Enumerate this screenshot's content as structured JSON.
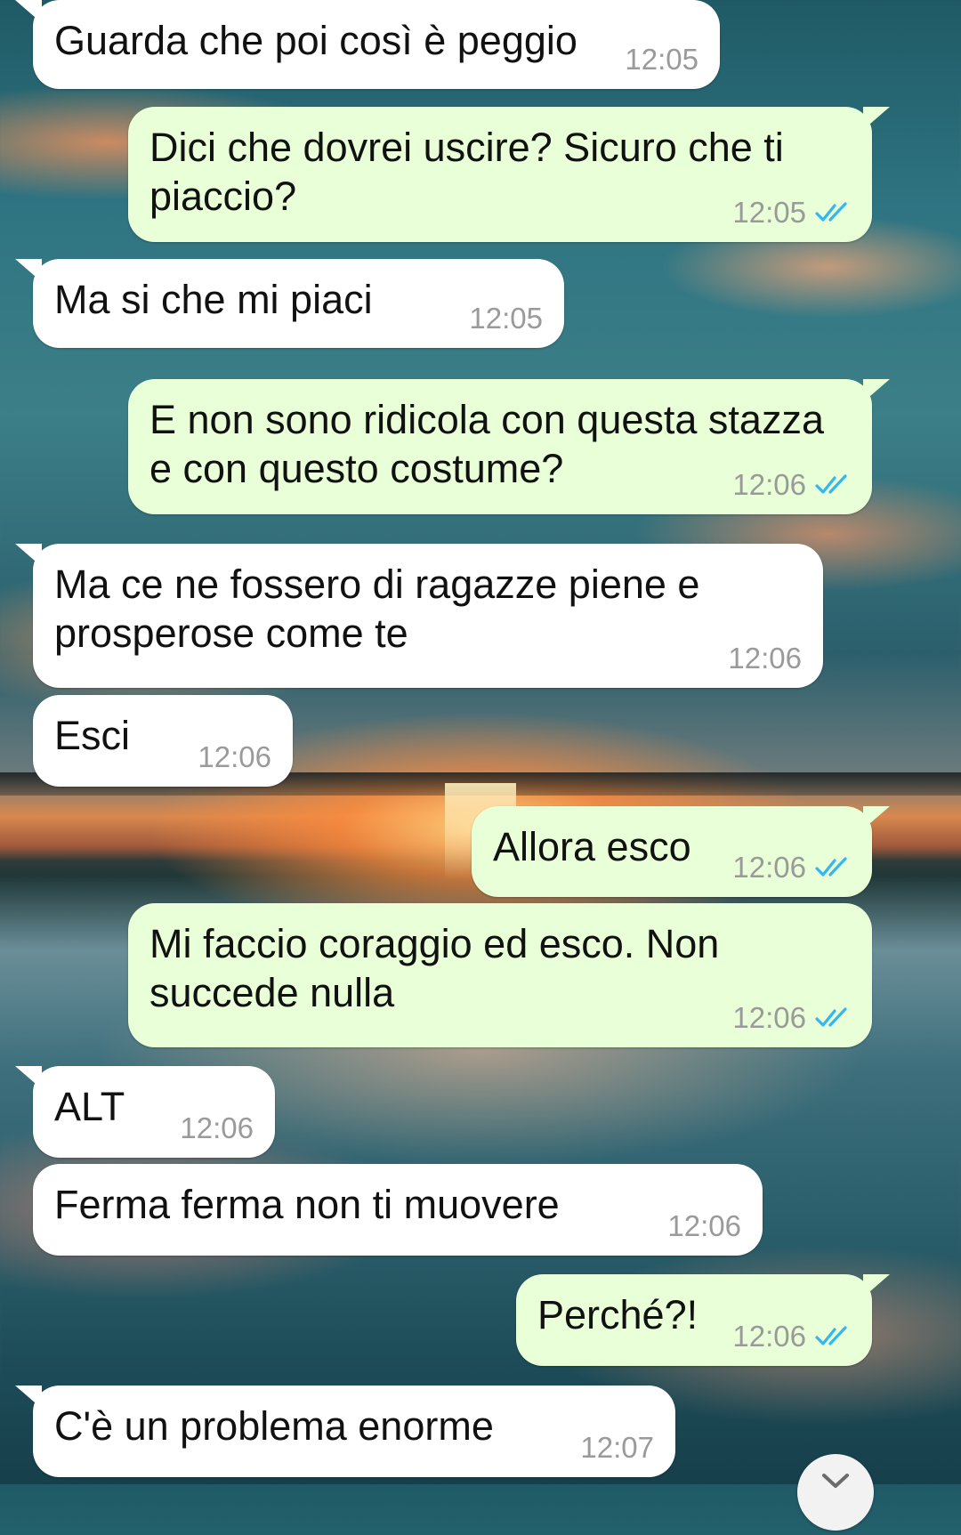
{
  "messages": [
    {
      "direction": "in",
      "text": "Guarda che poi così è peggio",
      "time": "12:05"
    },
    {
      "direction": "out",
      "text": "Dici che dovrei uscire? Sicuro che ti\npiaccio?",
      "time": "12:05",
      "status": "read"
    },
    {
      "direction": "in",
      "text": "Ma si che mi piaci",
      "time": "12:05"
    },
    {
      "direction": "out",
      "text": "E non sono ridicola con questa stazza\ne con questo costume?",
      "time": "12:06",
      "status": "read"
    },
    {
      "direction": "in",
      "text": "Ma ce ne fossero di ragazze piene e\nprosperose come te",
      "time": "12:06"
    },
    {
      "direction": "in",
      "text": "Esci",
      "time": "12:06"
    },
    {
      "direction": "out",
      "text": "Allora esco",
      "time": "12:06",
      "status": "read"
    },
    {
      "direction": "out",
      "text": "Mi faccio coraggio ed esco. Non\nsuccede nulla",
      "time": "12:06",
      "status": "read"
    },
    {
      "direction": "in",
      "text": "ALT",
      "time": "12:06"
    },
    {
      "direction": "in",
      "text": "Ferma ferma non ti muovere",
      "time": "12:06"
    },
    {
      "direction": "out",
      "text": "Perché?!",
      "time": "12:06",
      "status": "read"
    },
    {
      "direction": "in",
      "text": "C'è un problema enorme",
      "time": "12:07"
    }
  ],
  "icons": {
    "read_receipt": "double-check-icon",
    "scroll_down": "chevron-down-icon"
  },
  "colors": {
    "incoming_bubble": "#ffffff",
    "outgoing_bubble": "#e8ffd8",
    "read_tick": "#34b7f1",
    "timestamp": "#9a9a9a"
  }
}
